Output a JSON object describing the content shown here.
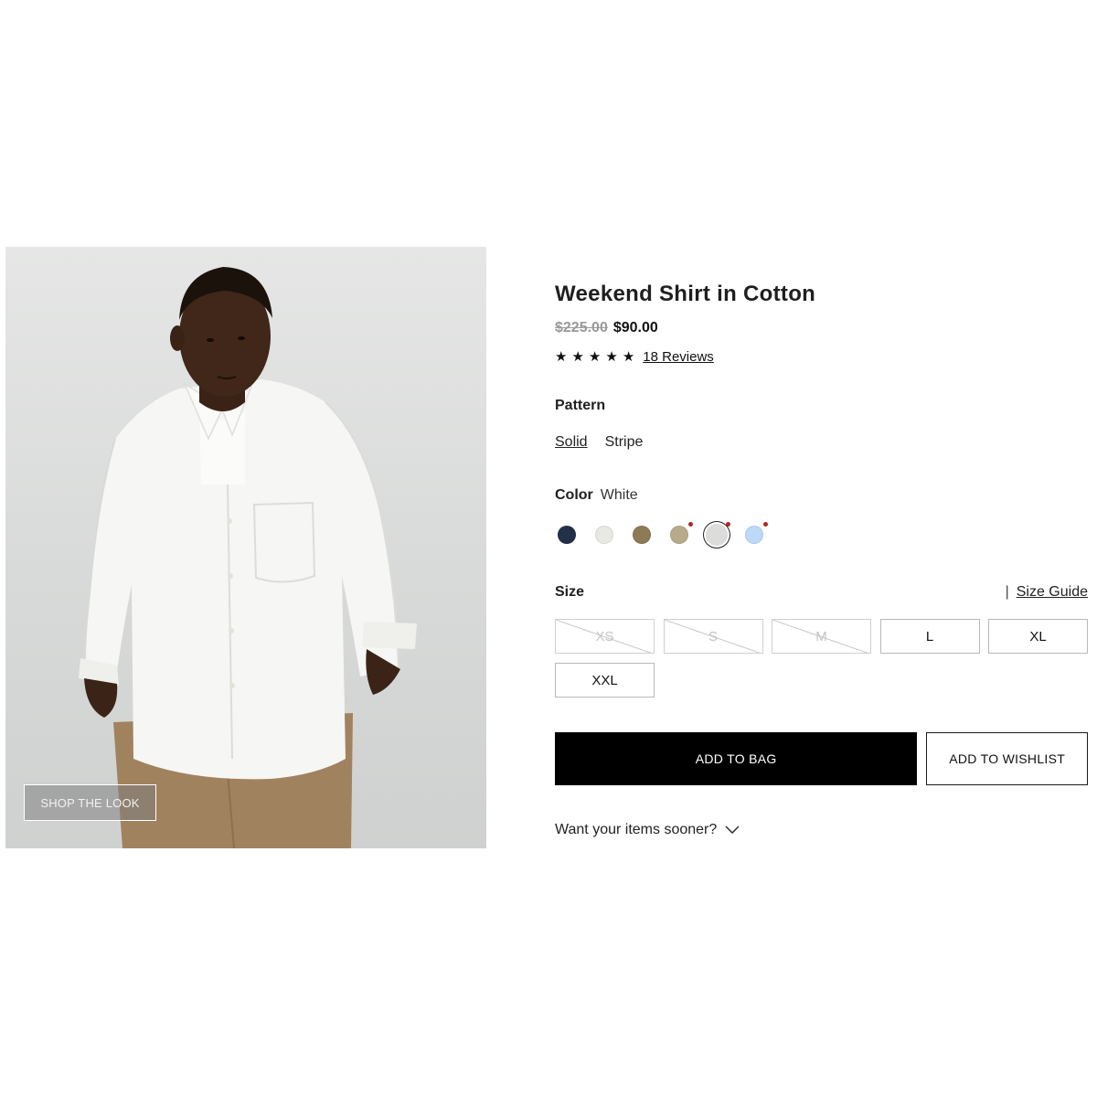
{
  "product": {
    "title": "Weekend Shirt in Cotton",
    "price_original": "$225.00",
    "price_sale": "$90.00",
    "rating_stars": 5,
    "reviews_label": "18 Reviews"
  },
  "photo": {
    "shop_the_look_label": "SHOP THE LOOK"
  },
  "pattern": {
    "label": "Pattern",
    "options": [
      {
        "label": "Solid",
        "selected": true
      },
      {
        "label": "Stripe",
        "selected": false
      }
    ]
  },
  "color": {
    "label": "Color",
    "selected_value": "White",
    "swatches": [
      {
        "color": "#23304a",
        "sale": false,
        "selected": false
      },
      {
        "color": "#e9e9e4",
        "sale": false,
        "selected": false
      },
      {
        "color": "#8f7a57",
        "sale": false,
        "selected": false
      },
      {
        "color": "#b8ab8c",
        "sale": true,
        "selected": false
      },
      {
        "color": "#dcdcda",
        "sale": true,
        "selected": true
      },
      {
        "color": "#bcd9f7",
        "sale": true,
        "selected": false
      }
    ]
  },
  "size": {
    "label": "Size",
    "guide_label": "Size Guide",
    "options": [
      {
        "label": "XS",
        "available": false
      },
      {
        "label": "S",
        "available": false
      },
      {
        "label": "M",
        "available": false
      },
      {
        "label": "L",
        "available": true
      },
      {
        "label": "XL",
        "available": true
      },
      {
        "label": "XXL",
        "available": true
      }
    ]
  },
  "actions": {
    "add_to_bag": "ADD TO BAG",
    "add_to_wishlist": "ADD TO WISHLIST",
    "sooner_label": "Want your items sooner?"
  }
}
